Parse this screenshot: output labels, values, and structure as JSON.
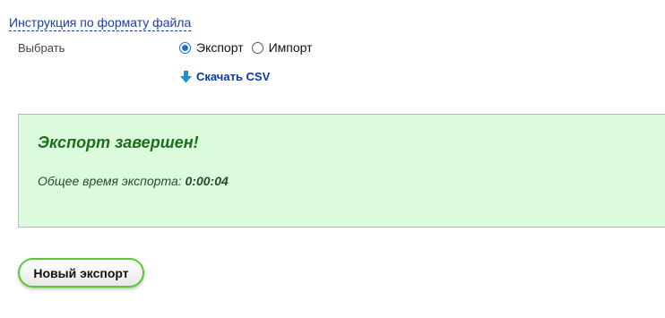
{
  "instruction_link": "Инструкция по формату файла",
  "select": {
    "label": "Выбрать",
    "options": [
      {
        "label": "Экспорт",
        "checked": true
      },
      {
        "label": "Импорт",
        "checked": false
      }
    ]
  },
  "download": {
    "label": "Скачать CSV",
    "icon": "download-arrow-icon",
    "icon_color": "#1e8fd6"
  },
  "result": {
    "title": "Экспорт завершен!",
    "time_label": "Общее время экспорта:",
    "time_value": "0:00:04",
    "background_color": "#dcfbdc",
    "title_color": "#1c6e1c"
  },
  "new_export_button": "Новый экспорт",
  "accent_color": "#58c92e"
}
